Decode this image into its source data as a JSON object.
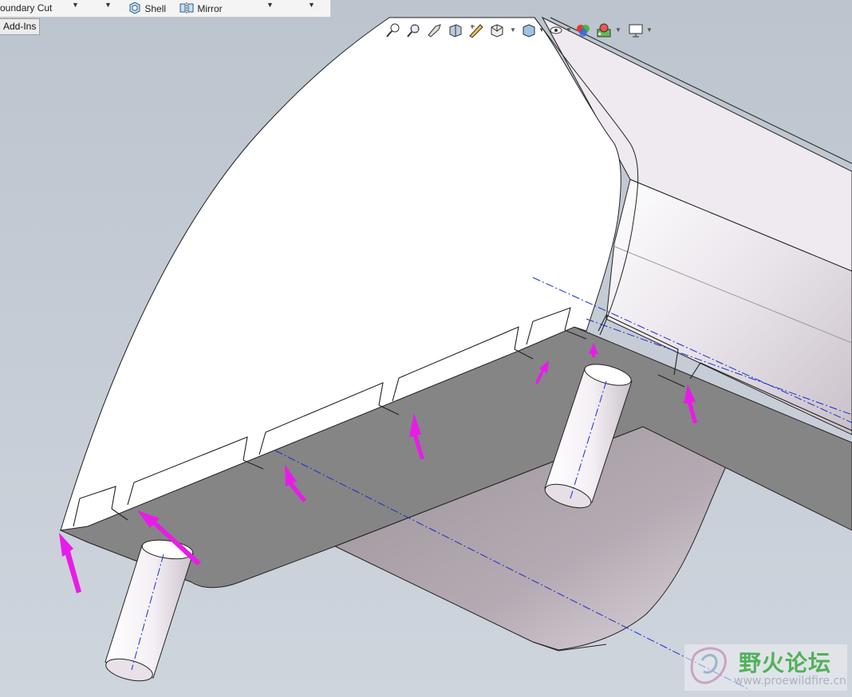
{
  "ribbon": {
    "boundary_cut_label": "oundary Cut",
    "shell_label": "Shell",
    "mirror_label": "Mirror"
  },
  "tabs": {
    "addins_label": "Add-Ins"
  },
  "heads_up_toolbar": {
    "icons": [
      "zoom-to-fit-icon",
      "zoom-to-area-icon",
      "previous-view-icon",
      "section-view-icon",
      "dynamic-annotation-icon",
      "view-orientation-icon",
      "display-style-icon",
      "hide-show-items-icon",
      "edit-appearance-icon",
      "apply-scene-icon",
      "view-settings-icon"
    ]
  },
  "model": {
    "top_face_color": "#ffffff",
    "bottom_face_color": "#858585",
    "flange_color": "#ddd6dd",
    "arrow_color": "#e81ce8",
    "axis_color": "#1a2ecc",
    "arrow_count": 7,
    "shaft_count": 2
  },
  "watermark": {
    "title": "野火论坛",
    "url": "www.proewildfire.cn"
  }
}
